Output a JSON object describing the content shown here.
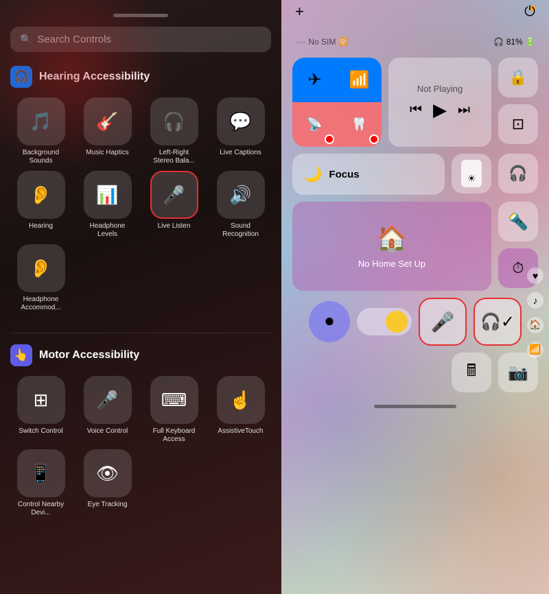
{
  "left": {
    "search_placeholder": "Search Controls",
    "hearing_section": {
      "title": "Hearing Accessibility",
      "icon": "🎧",
      "items": [
        {
          "id": "background-sounds",
          "icon": "🎵",
          "label": "Background Sounds"
        },
        {
          "id": "music-haptics",
          "icon": "🎸",
          "label": "Music Haptics"
        },
        {
          "id": "left-right-stereo",
          "icon": "🎧",
          "label": "Left-Right Stereo Bala..."
        },
        {
          "id": "live-captions",
          "icon": "💬",
          "label": "Live Captions"
        },
        {
          "id": "hearing",
          "icon": "👂",
          "label": "Hearing"
        },
        {
          "id": "headphone-levels",
          "icon": "📊",
          "label": "Headphone Levels"
        },
        {
          "id": "live-listen",
          "icon": "🎤",
          "label": "Live Listen",
          "highlighted": true
        },
        {
          "id": "sound-recognition",
          "icon": "🔊",
          "label": "Sound Recognition"
        },
        {
          "id": "headphone-accommodations",
          "icon": "👂",
          "label": "Headphone Accommod..."
        }
      ]
    },
    "motor_section": {
      "title": "Motor Accessibility",
      "icon": "👆",
      "items": [
        {
          "id": "switch-control",
          "icon": "⊞",
          "label": "Switch Control"
        },
        {
          "id": "voice-control",
          "icon": "🎤",
          "label": "Voice Control"
        },
        {
          "id": "full-keyboard-access",
          "icon": "⌨",
          "label": "Full Keyboard Access"
        },
        {
          "id": "assistive-touch",
          "icon": "☝",
          "label": "AssistiveTouch"
        },
        {
          "id": "control-nearby",
          "icon": "📱",
          "label": "Control Nearby Devi..."
        },
        {
          "id": "eye-tracking",
          "icon": "👁",
          "label": "Eye Tracking"
        }
      ]
    }
  },
  "right": {
    "orange_dot": true,
    "status": {
      "dots": "····",
      "carrier": "No SIM",
      "wifi": "WiFi",
      "headphone": "🎧",
      "battery": "81%"
    },
    "add_label": "+",
    "power_label": "⏻",
    "not_playing": {
      "label": "Not Playing",
      "prev": "⏮",
      "play": "▶",
      "next": "⏭"
    },
    "focus_label": "Focus",
    "no_home_label": "No Home Set Up",
    "tiles": {
      "airplane": "✈",
      "wifi": "📶",
      "bluetooth": "🦷",
      "cellular": "📡",
      "lock_rotation": "🔒",
      "screen_mirror": "⊡",
      "moon": "🌙",
      "brightness_sun": "☀",
      "headphones_icon": "🎧",
      "torch": "🔦",
      "timer": "⏱",
      "calculator": "🖩",
      "camera": "📷",
      "record": "🎙",
      "listen": "🎧"
    }
  }
}
